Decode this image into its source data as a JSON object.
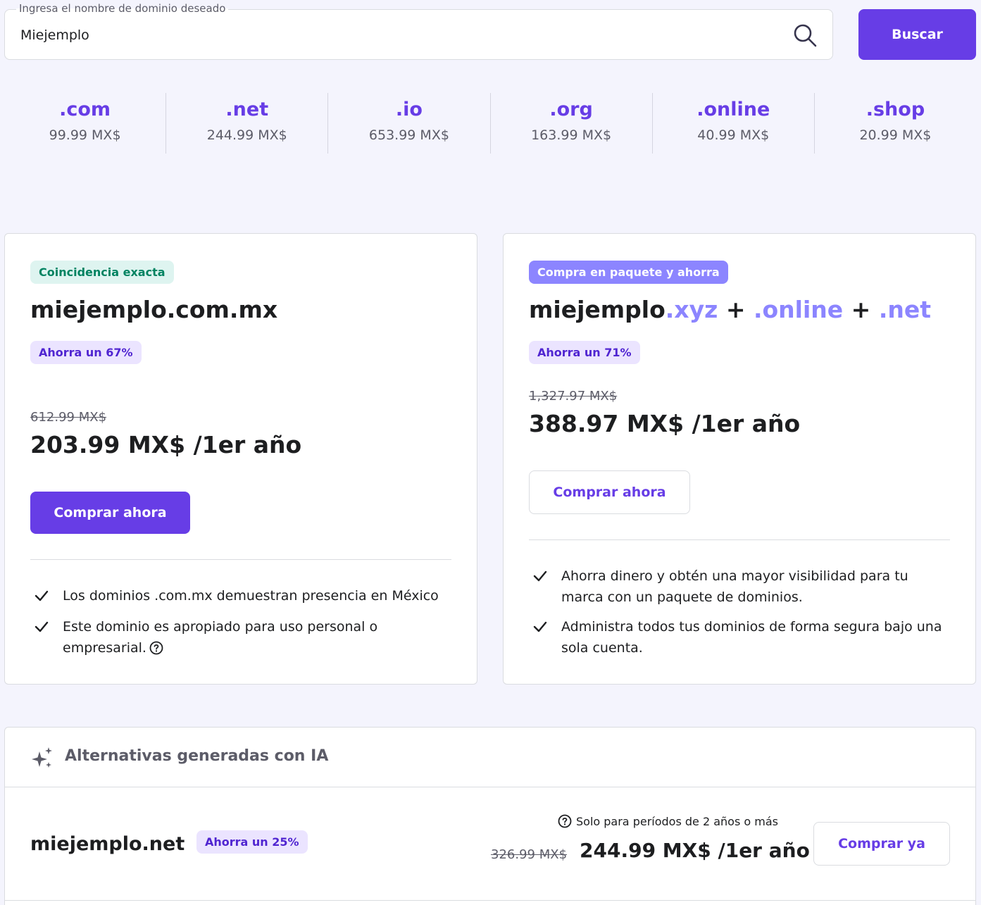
{
  "search": {
    "label": "Ingresa el nombre de dominio deseado",
    "value": "Miejemplo",
    "button": "Buscar"
  },
  "tlds": [
    {
      "name": ".com",
      "price": "99.99 MX$"
    },
    {
      "name": ".net",
      "price": "244.99 MX$"
    },
    {
      "name": ".io",
      "price": "653.99 MX$"
    },
    {
      "name": ".org",
      "price": "163.99 MX$"
    },
    {
      "name": ".online",
      "price": "40.99 MX$"
    },
    {
      "name": ".shop",
      "price": "20.99 MX$"
    }
  ],
  "exact_match": {
    "badge": "Coincidencia exacta",
    "domain": "miejemplo.com.mx",
    "savings": "Ahorra un 67%",
    "old_price": "612.99 MX$",
    "price": "203.99 MX$ /1er año",
    "button": "Comprar ahora",
    "features": [
      "Los dominios .com.mx demuestran presencia en México",
      "Este dominio es apropiado para uso personal o empresarial."
    ]
  },
  "bundle": {
    "badge": "Compra en paquete y ahorra",
    "domain_base": "miejemplo",
    "ext1": ".xyz",
    "plus": "+",
    "ext2": ".online",
    "ext3": ".net",
    "savings": "Ahorra un 71%",
    "old_price": "1,327.97 MX$",
    "price": "388.97 MX$ /1er año",
    "button": "Comprar ahora",
    "features": [
      "Ahorra dinero y obtén una mayor visibilidad para tu marca con un paquete de dominios.",
      "Administra todos tus dominios de forma segura bajo una sola cuenta."
    ]
  },
  "ai": {
    "title": "Alternativas generadas con IA",
    "items": [
      {
        "domain": "miejemplo.net",
        "savings": "Ahorra un 25%",
        "note": "Solo para períodos de 2 años o más",
        "old_price": "326.99 MX$",
        "price": "244.99 MX$ /1er año",
        "button": "Comprar ya"
      }
    ]
  },
  "colors": {
    "primary": "#673de6",
    "accent": "#8c85ff",
    "success": "#008361",
    "background": "#f4f4fd"
  }
}
